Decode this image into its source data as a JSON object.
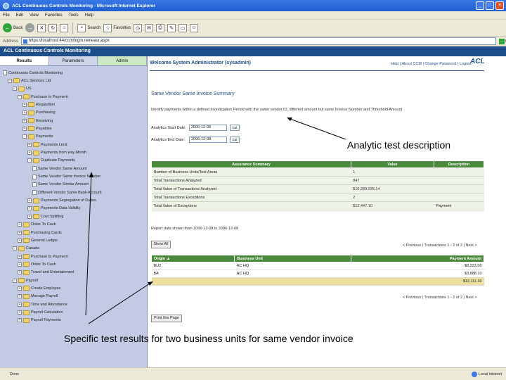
{
  "browser": {
    "title": "ACL Continuous Controls Monitoring - Microsoft Internet Explorer",
    "menu": [
      "File",
      "Edit",
      "View",
      "Favorites",
      "Tools",
      "Help"
    ],
    "back_label": "Back",
    "search_label": "Search",
    "favorites_label": "Favorites",
    "address_label": "Address",
    "address_value": "https://localhost:44/ccm/login.remeasr.aspx",
    "go_label": "Go",
    "status_text": "Done",
    "zone_text": "Local intranet"
  },
  "app": {
    "header_title": "ACL Continuous Controls Monitoring",
    "welcome": "Welcome System Administrator (sysadmin)",
    "top_links": "Help | About CCM | Change Password | Logout",
    "logo": "ACL"
  },
  "tabs": [
    "Results",
    "Parameters",
    "Admin"
  ],
  "tree": [
    {
      "label": "Continuous Controls Monitoring",
      "level": 0,
      "kind": "doc"
    },
    {
      "label": "ACL Services Ltd",
      "level": 1,
      "kind": "folder",
      "pm": "-"
    },
    {
      "label": "US",
      "level": 2,
      "kind": "folder",
      "pm": "-"
    },
    {
      "label": "Purchase to Payment",
      "level": 3,
      "kind": "folder",
      "pm": "-"
    },
    {
      "label": "Requisition",
      "level": 4,
      "kind": "folder",
      "pm": "+"
    },
    {
      "label": "Purchasing",
      "level": 4,
      "kind": "folder",
      "pm": "+"
    },
    {
      "label": "Receiving",
      "level": 4,
      "kind": "folder",
      "pm": "+"
    },
    {
      "label": "Payables",
      "level": 4,
      "kind": "folder",
      "pm": "+"
    },
    {
      "label": "Payments",
      "level": 4,
      "kind": "folder",
      "pm": "-"
    },
    {
      "label": "Payments Limit",
      "level": 5,
      "kind": "folder",
      "pm": "+"
    },
    {
      "label": "Payments from way Month",
      "level": 5,
      "kind": "folder",
      "pm": "+"
    },
    {
      "label": "Duplicate Payments",
      "level": 5,
      "kind": "folder",
      "pm": "-"
    },
    {
      "label": "Same Vendor Same Amount",
      "level": 6,
      "kind": "doc"
    },
    {
      "label": "Same Vendor Same Invoice Number",
      "level": 6,
      "kind": "doc"
    },
    {
      "label": "Same Vendor Similar Amount",
      "level": 6,
      "kind": "doc"
    },
    {
      "label": "Different Vendor Same Bank Account",
      "level": 6,
      "kind": "doc"
    },
    {
      "label": "Payments Segregation of Duties",
      "level": 5,
      "kind": "folder",
      "pm": "+"
    },
    {
      "label": "Payments Data Validity",
      "level": 5,
      "kind": "folder",
      "pm": "+"
    },
    {
      "label": "Cost Splitting",
      "level": 5,
      "kind": "folder",
      "pm": "+"
    },
    {
      "label": "Order To Cash",
      "level": 3,
      "kind": "folder",
      "pm": "+"
    },
    {
      "label": "Purchasing Cards",
      "level": 3,
      "kind": "folder",
      "pm": "+"
    },
    {
      "label": "General Ledger",
      "level": 3,
      "kind": "folder",
      "pm": "+"
    },
    {
      "label": "Canada",
      "level": 2,
      "kind": "folder",
      "pm": "-"
    },
    {
      "label": "Purchase to Payment",
      "level": 3,
      "kind": "folder",
      "pm": "+"
    },
    {
      "label": "Order To Cash",
      "level": 3,
      "kind": "folder",
      "pm": "+"
    },
    {
      "label": "Travel and Entertainment",
      "level": 3,
      "kind": "folder",
      "pm": "+"
    },
    {
      "label": "Payroll",
      "level": 2,
      "kind": "folder",
      "pm": "-"
    },
    {
      "label": "Create Employee",
      "level": 3,
      "kind": "folder",
      "pm": "+"
    },
    {
      "label": "Manage Payroll",
      "level": 3,
      "kind": "folder",
      "pm": "+"
    },
    {
      "label": "Time and Attendance",
      "level": 3,
      "kind": "folder",
      "pm": "+"
    },
    {
      "label": "Payroll Calculation",
      "level": 3,
      "kind": "folder",
      "pm": "+"
    },
    {
      "label": "Payroll Payments",
      "level": 3,
      "kind": "folder",
      "pm": "+"
    }
  ],
  "main": {
    "page_title": "Same Vendor Same Invoice Summary",
    "description": "Identify payments within a defined Investigation Period with the same vendor ID, different amount but same Invoice Number and Threshold Amount",
    "start_label": "Analytics Start Date:",
    "start_value": "2006-12-08",
    "end_label": "Analytics End Date:",
    "end_value": "2006-12-08",
    "cal_label": "Cal",
    "summary_headers": [
      "Assurance Summary",
      "Value",
      "Description"
    ],
    "summary_rows": [
      [
        "Number of Business Units/Test Areas",
        "1",
        ""
      ],
      [
        "Total Transactions Analyzed",
        "847",
        ""
      ],
      [
        "Total Value of Transactions Analyzed",
        "$10,289,935.14",
        ""
      ],
      [
        "Total Transactions Exceptions",
        "2",
        ""
      ],
      [
        "Total Value of Exceptions",
        "$12,447.10",
        "Payment"
      ]
    ],
    "report_dates": "Report data shown from 2006-12-08 to 2006-12-08",
    "show_all": "Show All",
    "pager": "< Previous  |  Transactions 1 - 2 of 2  |  Next >",
    "pager_bottom": "< Previous  |  Transactions 1 - 2 of 2  |  Next >",
    "results_headers": [
      "Origin ▲",
      "Business Unit",
      "Payment Amount"
    ],
    "results_rows": [
      [
        "BU2",
        "AC HQ",
        "$8,223.00"
      ],
      [
        "BA",
        "AC HQ",
        "$3,888.10"
      ]
    ],
    "results_total": "$12,111.10",
    "print_label": "Print this Page"
  },
  "annotations": {
    "analytic": "Analytic test description",
    "specific": "Specific test results for two business units for same vendor invoice"
  }
}
